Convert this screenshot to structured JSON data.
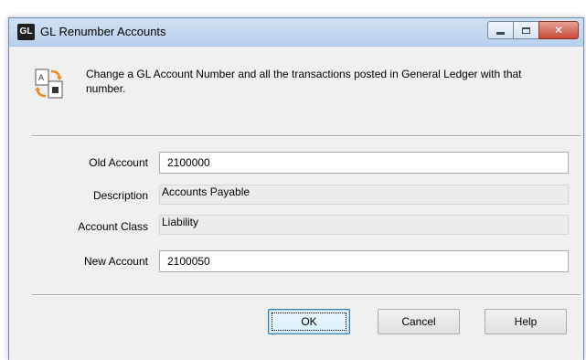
{
  "window": {
    "app_badge": "GL",
    "title": "GL Renumber Accounts",
    "close_glyph": "✕"
  },
  "header": {
    "icon": "renumber-accounts-icon",
    "description": "Change a GL Account Number and all the transactions posted in General Ledger with that number."
  },
  "form": {
    "old_account_label": "Old Account",
    "old_account_value": "2100000",
    "description_label": "Description",
    "description_value": "Accounts Payable",
    "account_class_label": "Account Class",
    "account_class_value": "Liability",
    "new_account_label": "New Account",
    "new_account_value": "2100050"
  },
  "buttons": {
    "ok": "OK",
    "cancel": "Cancel",
    "help": "Help"
  },
  "colors": {
    "titlebar": "#c4d8f1",
    "close_button": "#c74a3a",
    "default_button_border": "#3c7fb1"
  }
}
